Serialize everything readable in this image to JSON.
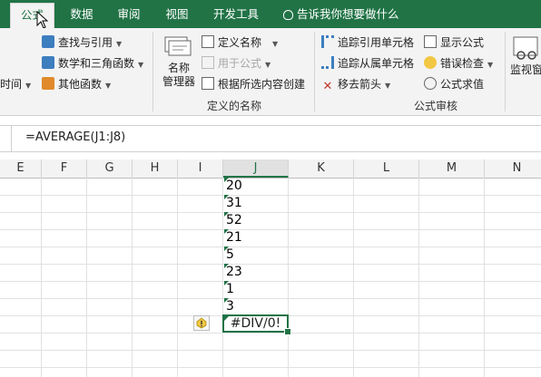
{
  "tabs": [
    {
      "label": "公式",
      "active": true
    },
    {
      "label": "数据"
    },
    {
      "label": "审阅"
    },
    {
      "label": "视图"
    },
    {
      "label": "开发工具"
    }
  ],
  "tell_me": "告诉我你想要做什么",
  "ribbon": {
    "left_partial": "时间",
    "lookup": "查找与引用",
    "math": "数学和三角函数",
    "other": "其他函数",
    "name_manager": [
      "名称",
      "管理器"
    ],
    "define_name": "定义名称",
    "use_in_formula": "用于公式",
    "create_from_selection": "根据所选内容创建",
    "group_defined_names": "定义的名称",
    "trace_precedents": "追踪引用单元格",
    "trace_dependents": "追踪从属单元格",
    "remove_arrows": "移去箭头",
    "show_formulas": "显示公式",
    "error_checking": "错误检查",
    "evaluate_formula": "公式求值",
    "group_formula_auditing": "公式审核",
    "watch_window_partial": "监视窗"
  },
  "formula_bar": {
    "formula": "=AVERAGE(J1:J8)"
  },
  "columns": [
    "E",
    "F",
    "G",
    "H",
    "I",
    "J",
    "K",
    "L",
    "M",
    "N"
  ],
  "selected_column": "J",
  "j_values": [
    "20",
    "31",
    "52",
    "21",
    "5",
    "23",
    "1",
    "3"
  ],
  "result": "#DIV/0!",
  "colors": {
    "accent": "#217346",
    "ribbon_bg": "#f3f3f3",
    "warning": "#f2c744"
  }
}
